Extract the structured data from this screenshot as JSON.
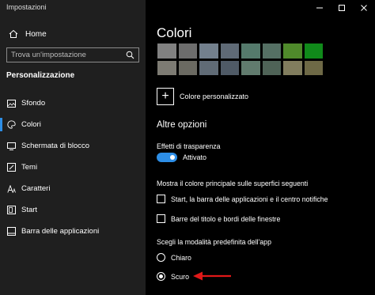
{
  "window": {
    "title": "Impostazioni"
  },
  "sidebar": {
    "home_label": "Home",
    "search_placeholder": "Trova un'impostazione",
    "section_title": "Personalizzazione",
    "items": [
      {
        "label": "Sfondo",
        "icon": "image-icon",
        "selected": false
      },
      {
        "label": "Colori",
        "icon": "palette-icon",
        "selected": true
      },
      {
        "label": "Schermata di blocco",
        "icon": "lock-screen-icon",
        "selected": false
      },
      {
        "label": "Temi",
        "icon": "brush-icon",
        "selected": false
      },
      {
        "label": "Caratteri",
        "icon": "font-icon",
        "selected": false
      },
      {
        "label": "Start",
        "icon": "start-icon",
        "selected": false
      },
      {
        "label": "Barra delle applicazioni",
        "icon": "taskbar-icon",
        "selected": false
      }
    ]
  },
  "main": {
    "title": "Colori",
    "swatch_colors": [
      "#818181",
      "#6d6d6d",
      "#73808d",
      "#5f6a76",
      "#557a6c",
      "#557064",
      "#4f8a2b",
      "#108a1a",
      "#7d7b73",
      "#6b6a62",
      "#606b76",
      "#4f5a66",
      "#617b6e",
      "#4f6357",
      "#817d5e",
      "#6e6946"
    ],
    "custom_color_label": "Colore personalizzato",
    "other_options_title": "Altre opzioni",
    "transparency_label": "Effetti di trasparenza",
    "transparency_state": "Attivato",
    "transparency_on": true,
    "accent_surfaces_label": "Mostra il colore principale sulle superfici seguenti",
    "checkboxes": [
      {
        "label": "Start, la barra delle applicazioni e il centro notifiche",
        "checked": false
      },
      {
        "label": "Barre del titolo e bordi delle finestre",
        "checked": false
      }
    ],
    "app_mode_label": "Scegli la modalità predefinita dell'app",
    "app_modes": [
      {
        "label": "Chiaro",
        "selected": false
      },
      {
        "label": "Scuro",
        "selected": true
      }
    ]
  },
  "colors": {
    "accent": "#2d8ee6",
    "annotation_arrow": "#e01818",
    "sidebar_bg": "#1f1f1f",
    "main_bg": "#000000"
  }
}
